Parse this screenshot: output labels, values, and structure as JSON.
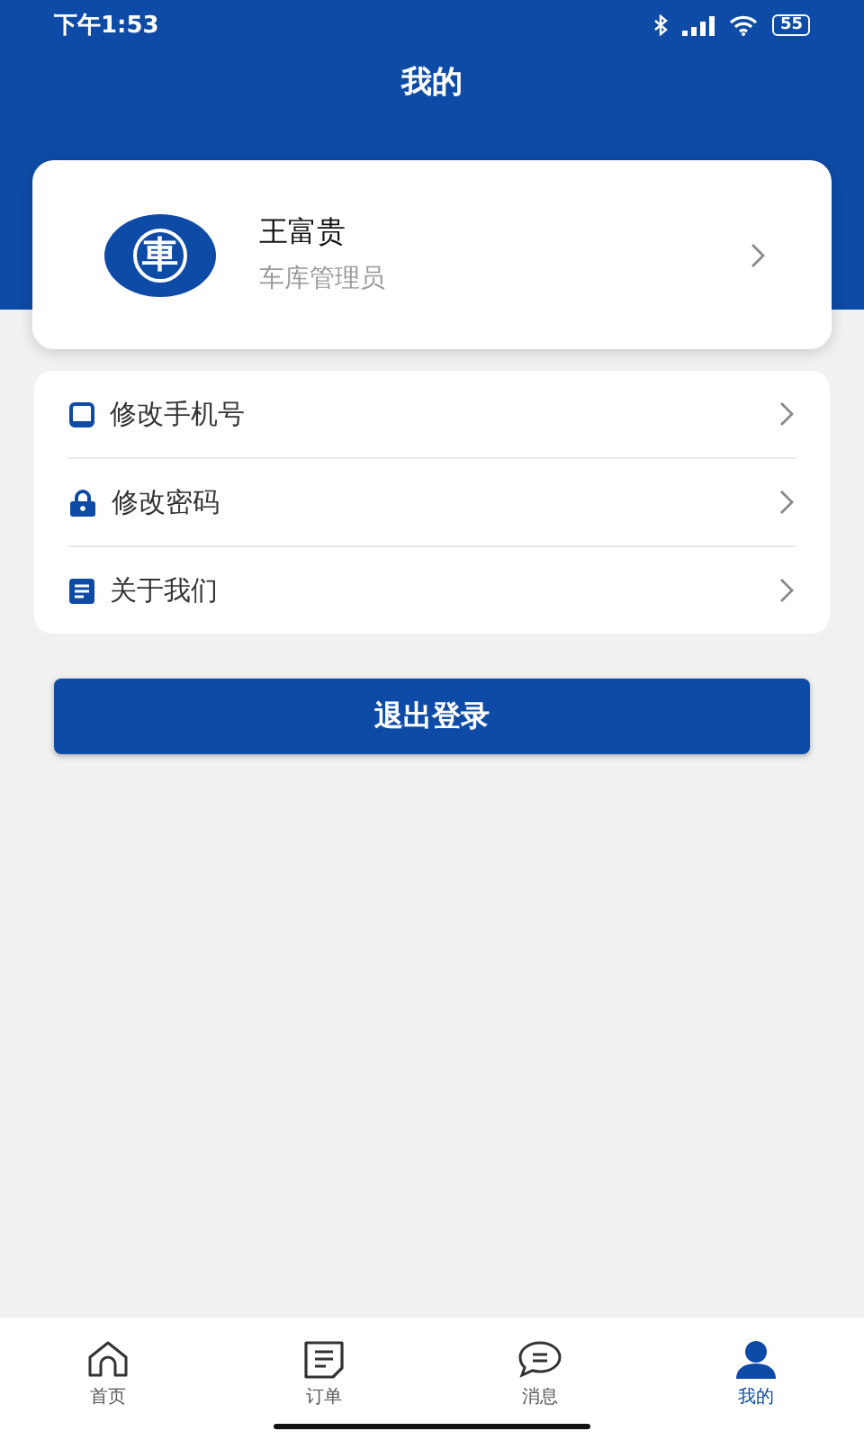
{
  "status_bar": {
    "time": "下午1:53",
    "battery": "55"
  },
  "header": {
    "title": "我的"
  },
  "profile": {
    "logo_text": "車",
    "name": "王富贵",
    "role": "车库管理员"
  },
  "menu": [
    {
      "kind": "phone",
      "label": "修改手机号"
    },
    {
      "kind": "lock",
      "label": "修改密码"
    },
    {
      "kind": "doc",
      "label": "关于我们"
    }
  ],
  "logout_button": "退出登录",
  "tab_bar": [
    {
      "kind": "home",
      "label": "首页",
      "selected": false
    },
    {
      "kind": "orders",
      "label": "订单",
      "selected": false
    },
    {
      "kind": "messages",
      "label": "消息",
      "selected": false
    },
    {
      "kind": "profile",
      "label": "我的",
      "selected": true
    }
  ]
}
